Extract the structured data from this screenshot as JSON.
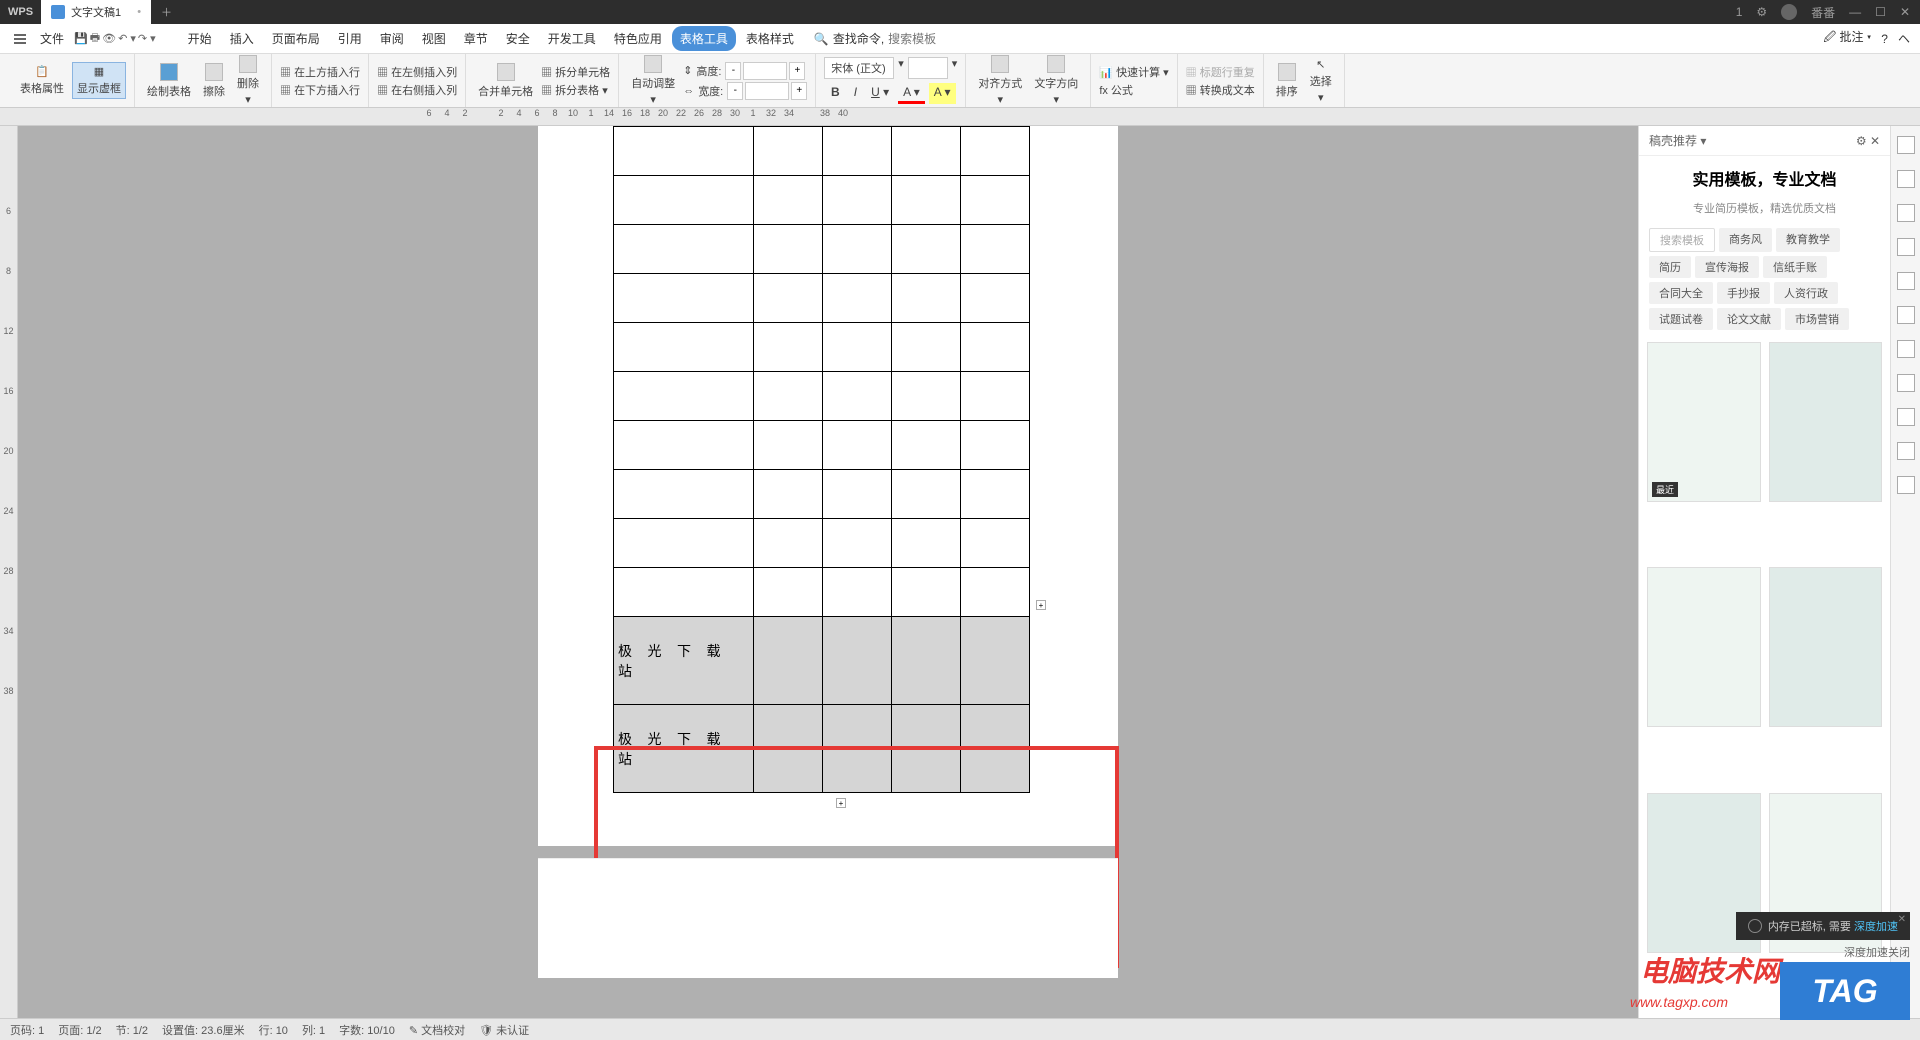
{
  "titlebar": {
    "app_name": "WPS",
    "tab_name": "文字文稿1",
    "user_name": "番番"
  },
  "menubar": {
    "file": "文件",
    "items": [
      "开始",
      "插入",
      "页面布局",
      "引用",
      "审阅",
      "视图",
      "章节",
      "安全",
      "开发工具",
      "特色应用",
      "表格工具",
      "表格样式"
    ],
    "active_index": 10,
    "search_label": "查找命令,",
    "search_placeholder": "搜索模板",
    "comment": "批注"
  },
  "ribbon": {
    "table_props": "表格属性",
    "show_frame": "显示虚框",
    "draw_table": "绘制表格",
    "eraser": "擦除",
    "delete": "删除",
    "insert_above": "在上方插入行",
    "insert_left": "在左侧插入列",
    "insert_below": "在下方插入行",
    "insert_right": "在右侧插入列",
    "merge_cells": "合并单元格",
    "split_cells": "拆分单元格",
    "split_table": "拆分表格",
    "auto_adjust": "自动调整",
    "height_label": "高度:",
    "width_label": "宽度:",
    "font_name": "宋体 (正文)",
    "alignment": "对齐方式",
    "text_direction": "文字方向",
    "fast_calc": "快速计算",
    "formula": "fx 公式",
    "title_repeat": "标题行重复",
    "convert_text": "转换成文本",
    "sort": "排序",
    "select": "选择"
  },
  "ruler_h": [
    "6",
    "4",
    "2",
    "",
    "2",
    "4",
    "6",
    "8",
    "10",
    "1",
    "14",
    "16",
    "18",
    "20",
    "22",
    "26",
    "28",
    "30",
    "1",
    "32",
    "34",
    "",
    "38",
    "40"
  ],
  "ruler_v": [
    "",
    "6",
    "8",
    "12",
    "16",
    "20",
    "24",
    "28",
    "34",
    "38"
  ],
  "table_content": {
    "cell_text_1": "极 光 下 载",
    "cell_text_2": "站",
    "cell_text_3": "极 光 下 载",
    "cell_text_4": "站"
  },
  "right_panel": {
    "header": "稿壳推荐",
    "title": "实用模板，专业文档",
    "subtitle": "专业简历模板，精选优质文档",
    "search_placeholder": "搜索模板",
    "tags_row1": [
      "商务风",
      "教育教学"
    ],
    "tags_row2": [
      "简历",
      "宣传海报",
      "信纸手账"
    ],
    "tags_row3": [
      "合同大全",
      "手抄报",
      "人资行政"
    ],
    "tags_row4": [
      "试题试卷",
      "论文文献",
      "市场营销"
    ],
    "badge": "最近"
  },
  "toast": {
    "text1": "内存已超标, 需要",
    "text2": "深度加速",
    "text3": "深度加速关闭"
  },
  "statusbar": {
    "page_num": "页码: 1",
    "page_total": "页面: 1/2",
    "section": "节: 1/2",
    "setting": "设置值: 23.6厘米",
    "row": "行: 10",
    "col": "列: 1",
    "chars": "字数: 10/10",
    "proofing": "文档校对",
    "auth": "未认证"
  },
  "watermark": {
    "main": "电脑技术网",
    "sub": "www.tagxp.com",
    "tag": "TAG"
  }
}
